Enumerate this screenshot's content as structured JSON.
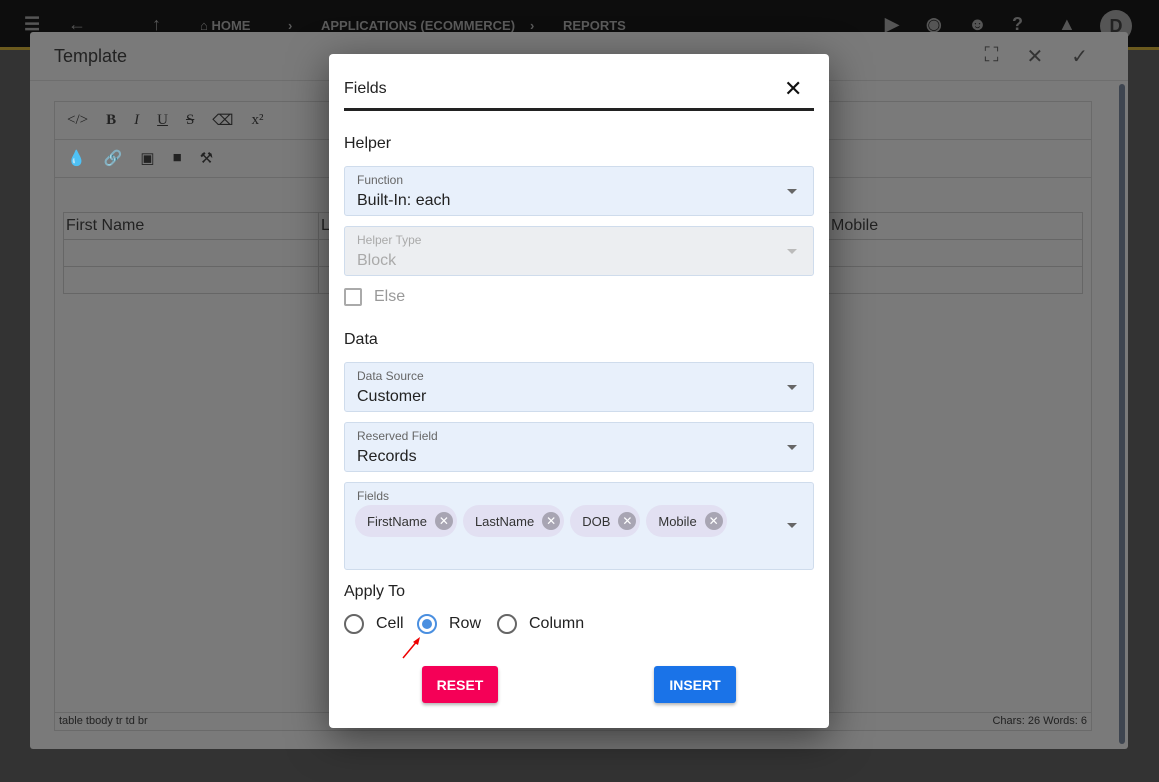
{
  "topbar": {
    "breadcrumbs": [
      "HOME",
      "APPLICATIONS (ECOMMERCE)",
      "REPORTS"
    ],
    "avatar": "D"
  },
  "template": {
    "title": "Template",
    "table_headers": [
      "First Name",
      "L",
      "Mobile"
    ],
    "status_path": "table  tbody  tr  td  br",
    "status_counts": "Chars: 26  Words: 6"
  },
  "modal": {
    "title": "Fields",
    "helper_heading": "Helper",
    "function": {
      "label": "Function",
      "value": "Built-In: each"
    },
    "helper_type": {
      "label": "Helper Type",
      "value": "Block",
      "disabled": true
    },
    "else_label": "Else",
    "else_checked": false,
    "data_heading": "Data",
    "data_source": {
      "label": "Data Source",
      "value": "Customer"
    },
    "reserved_field": {
      "label": "Reserved Field",
      "value": "Records"
    },
    "fields": {
      "label": "Fields",
      "chips": [
        "FirstName",
        "LastName",
        "DOB",
        "Mobile"
      ]
    },
    "apply_heading": "Apply To",
    "apply_options": [
      "Cell",
      "Row",
      "Column"
    ],
    "apply_selected": "Row",
    "reset_label": "RESET",
    "insert_label": "INSERT",
    "colors": {
      "reset": "#f50057",
      "insert": "#1a73e8",
      "radio": "#4a8fe0"
    }
  }
}
